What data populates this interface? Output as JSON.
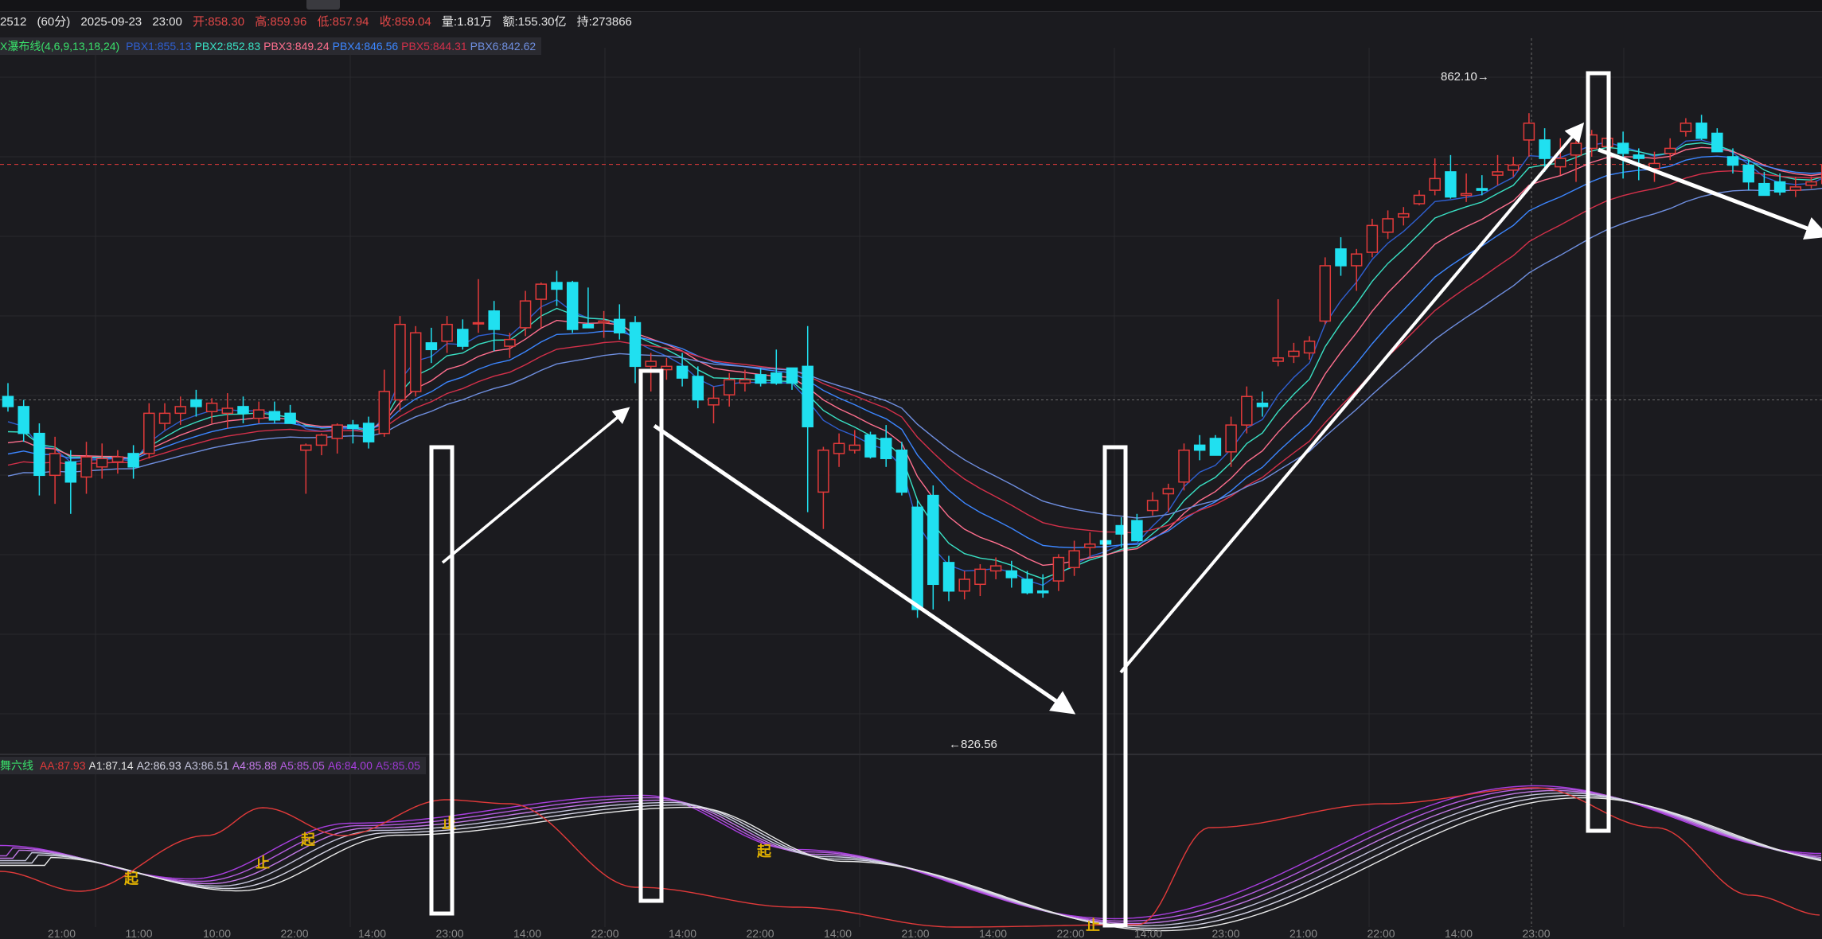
{
  "header": {
    "symbol": "2512",
    "period": "(60分)",
    "date": "2025-09-23",
    "time": "23:00",
    "open": "开:858.30",
    "high": "高:859.96",
    "low": "低:857.94",
    "close": "收:859.04",
    "volume": "量:1.81万",
    "amount": "额:155.30亿",
    "hold": "持:273866"
  },
  "legend_top": {
    "name": "X瀑布线(4,6,9,13,18,24)",
    "items": [
      {
        "text": "PBX1:855.13",
        "color": "#2f5fd0"
      },
      {
        "text": "PBX2:852.83",
        "color": "#39e0c4"
      },
      {
        "text": "PBX3:849.24",
        "color": "#ff6f8e"
      },
      {
        "text": "PBX4:846.56",
        "color": "#3c86ff"
      },
      {
        "text": "PBX5:844.31",
        "color": "#d4304a"
      },
      {
        "text": "PBX6:842.62",
        "color": "#6f8fe0"
      }
    ]
  },
  "legend_bottom": {
    "name": "舞六线",
    "items": [
      {
        "text": "AA:87.93",
        "color": "#e23a3a"
      },
      {
        "text": "A1:87.14",
        "color": "#e8e8e8"
      },
      {
        "text": "A2:86.93",
        "color": "#d6d6e6"
      },
      {
        "text": "A3:86.51",
        "color": "#c4c4dc"
      },
      {
        "text": "A4:85.88",
        "color": "#c27ae6"
      },
      {
        "text": "A5:85.05",
        "color": "#b55ce0"
      },
      {
        "text": "A6:84.00",
        "color": "#a93ee0"
      },
      {
        "text": "A5:85.05",
        "color": "#9a38d0"
      }
    ]
  },
  "annotations": {
    "high_label": "862.10→",
    "low_label": "←826.56"
  },
  "signals": [
    {
      "text": "起",
      "x": 165
    },
    {
      "text": "止",
      "x": 330
    },
    {
      "text": "起",
      "x": 387
    },
    {
      "text": "止",
      "x": 564
    },
    {
      "text": "起",
      "x": 960
    },
    {
      "text": "止",
      "x": 1373
    }
  ],
  "time_ticks": [
    "21:00",
    "11:00",
    "10:00",
    "22:00",
    "14:00",
    "23:00",
    "14:00",
    "22:00",
    "14:00",
    "22:00",
    "14:00",
    "21:00",
    "14:00",
    "22:00",
    "14:00",
    "23:00",
    "21:00",
    "22:00",
    "14:00",
    "23:00"
  ],
  "colors": {
    "up": "#e23a3a",
    "down": "#20e0f0",
    "background": "#1b1b1f",
    "grid": "#2a2a2e",
    "current_price_line": "#e23a3a",
    "crosshair": "#6a6a6a",
    "arrows": "#ffffff",
    "signal_text": "#e0b000"
  },
  "chart_data": {
    "type": "candlestick",
    "ylim": [
      824,
      866
    ],
    "current_price": 859.04,
    "crosshair_price": 845.0,
    "candles": [
      {
        "o": 845.2,
        "h": 846.0,
        "l": 844.3,
        "c": 844.6
      },
      {
        "o": 844.6,
        "h": 845.0,
        "l": 842.5,
        "c": 843.0
      },
      {
        "o": 843.0,
        "h": 843.6,
        "l": 839.3,
        "c": 840.5
      },
      {
        "o": 840.5,
        "h": 842.8,
        "l": 838.8,
        "c": 841.8
      },
      {
        "o": 841.3,
        "h": 842.0,
        "l": 838.2,
        "c": 840.1
      },
      {
        "o": 840.4,
        "h": 842.5,
        "l": 839.4,
        "c": 841.6
      },
      {
        "o": 841.0,
        "h": 842.4,
        "l": 840.3,
        "c": 841.5
      },
      {
        "o": 841.3,
        "h": 842.0,
        "l": 840.6,
        "c": 841.6
      },
      {
        "o": 841.8,
        "h": 842.3,
        "l": 840.3,
        "c": 841.0
      },
      {
        "o": 841.8,
        "h": 844.8,
        "l": 841.5,
        "c": 844.2
      },
      {
        "o": 843.6,
        "h": 844.8,
        "l": 843.2,
        "c": 844.2
      },
      {
        "o": 844.2,
        "h": 845.2,
        "l": 843.5,
        "c": 844.6
      },
      {
        "o": 845.0,
        "h": 845.6,
        "l": 844.0,
        "c": 844.6
      },
      {
        "o": 844.3,
        "h": 845.1,
        "l": 843.6,
        "c": 844.8
      },
      {
        "o": 844.2,
        "h": 845.4,
        "l": 843.3,
        "c": 844.5
      },
      {
        "o": 844.6,
        "h": 845.2,
        "l": 843.6,
        "c": 844.2
      },
      {
        "o": 843.9,
        "h": 844.9,
        "l": 843.6,
        "c": 844.4
      },
      {
        "o": 844.3,
        "h": 844.9,
        "l": 843.6,
        "c": 843.8
      },
      {
        "o": 844.2,
        "h": 844.7,
        "l": 843.7,
        "c": 843.6
      },
      {
        "o": 842.0,
        "h": 842.4,
        "l": 839.4,
        "c": 842.3
      },
      {
        "o": 842.3,
        "h": 843.0,
        "l": 841.7,
        "c": 842.9
      },
      {
        "o": 842.7,
        "h": 843.6,
        "l": 841.8,
        "c": 843.5
      },
      {
        "o": 843.5,
        "h": 843.8,
        "l": 842.4,
        "c": 843.3
      },
      {
        "o": 843.6,
        "h": 844.0,
        "l": 842.1,
        "c": 842.5
      },
      {
        "o": 843.0,
        "h": 846.8,
        "l": 842.8,
        "c": 845.5
      },
      {
        "o": 845.0,
        "h": 850.0,
        "l": 844.3,
        "c": 849.5
      },
      {
        "o": 845.5,
        "h": 849.4,
        "l": 845.2,
        "c": 849.0
      },
      {
        "o": 848.4,
        "h": 849.3,
        "l": 847.2,
        "c": 848.0
      },
      {
        "o": 848.5,
        "h": 850.0,
        "l": 847.8,
        "c": 849.5
      },
      {
        "o": 849.2,
        "h": 849.8,
        "l": 848.0,
        "c": 848.2
      },
      {
        "o": 849.6,
        "h": 852.2,
        "l": 849.0,
        "c": 849.6
      },
      {
        "o": 850.3,
        "h": 850.9,
        "l": 847.9,
        "c": 849.2
      },
      {
        "o": 848.2,
        "h": 849.0,
        "l": 847.5,
        "c": 848.6
      },
      {
        "o": 849.3,
        "h": 851.5,
        "l": 848.8,
        "c": 850.9
      },
      {
        "o": 851.0,
        "h": 852.0,
        "l": 849.3,
        "c": 851.9
      },
      {
        "o": 852.0,
        "h": 852.7,
        "l": 850.6,
        "c": 851.6
      },
      {
        "o": 852.0,
        "h": 852.1,
        "l": 849.0,
        "c": 849.2
      },
      {
        "o": 849.5,
        "h": 851.7,
        "l": 849.3,
        "c": 849.3
      },
      {
        "o": 849.6,
        "h": 850.3,
        "l": 848.7,
        "c": 849.7
      },
      {
        "o": 849.8,
        "h": 850.7,
        "l": 848.6,
        "c": 849.0
      },
      {
        "o": 849.6,
        "h": 850.0,
        "l": 846.0,
        "c": 847.0
      },
      {
        "o": 847.0,
        "h": 847.8,
        "l": 845.5,
        "c": 847.3
      },
      {
        "o": 846.8,
        "h": 847.5,
        "l": 846.2,
        "c": 847.0
      },
      {
        "o": 847.0,
        "h": 847.8,
        "l": 845.8,
        "c": 846.3
      },
      {
        "o": 846.4,
        "h": 847.0,
        "l": 844.5,
        "c": 845.0
      },
      {
        "o": 844.7,
        "h": 845.8,
        "l": 843.6,
        "c": 845.1
      },
      {
        "o": 845.3,
        "h": 846.6,
        "l": 844.6,
        "c": 846.2
      },
      {
        "o": 846.0,
        "h": 846.8,
        "l": 845.5,
        "c": 846.2
      },
      {
        "o": 846.5,
        "h": 846.9,
        "l": 845.8,
        "c": 846.0
      },
      {
        "o": 846.6,
        "h": 848.0,
        "l": 845.9,
        "c": 846.0
      },
      {
        "o": 846.9,
        "h": 846.8,
        "l": 845.6,
        "c": 846.0
      },
      {
        "o": 847.0,
        "h": 849.4,
        "l": 838.3,
        "c": 843.4
      },
      {
        "o": 839.5,
        "h": 842.2,
        "l": 837.3,
        "c": 842.0
      },
      {
        "o": 841.8,
        "h": 843.0,
        "l": 841.0,
        "c": 842.4
      },
      {
        "o": 842.0,
        "h": 843.2,
        "l": 841.8,
        "c": 842.3
      },
      {
        "o": 842.9,
        "h": 843.1,
        "l": 841.5,
        "c": 841.6
      },
      {
        "o": 842.7,
        "h": 843.5,
        "l": 841.0,
        "c": 841.5
      },
      {
        "o": 842.0,
        "h": 842.5,
        "l": 839.3,
        "c": 839.5
      },
      {
        "o": 838.6,
        "h": 839.0,
        "l": 832.0,
        "c": 832.5
      },
      {
        "o": 839.3,
        "h": 839.9,
        "l": 832.5,
        "c": 834.0
      },
      {
        "o": 835.3,
        "h": 835.7,
        "l": 833.0,
        "c": 833.6
      },
      {
        "o": 833.6,
        "h": 834.8,
        "l": 833.1,
        "c": 834.3
      },
      {
        "o": 834.0,
        "h": 835.2,
        "l": 833.3,
        "c": 834.9
      },
      {
        "o": 834.8,
        "h": 835.6,
        "l": 834.3,
        "c": 835.1
      },
      {
        "o": 834.8,
        "h": 835.4,
        "l": 833.8,
        "c": 834.4
      },
      {
        "o": 834.3,
        "h": 834.8,
        "l": 833.4,
        "c": 833.5
      },
      {
        "o": 833.6,
        "h": 834.6,
        "l": 833.2,
        "c": 833.5
      },
      {
        "o": 834.2,
        "h": 835.8,
        "l": 833.6,
        "c": 835.6
      },
      {
        "o": 835.0,
        "h": 836.6,
        "l": 834.5,
        "c": 836.0
      },
      {
        "o": 836.2,
        "h": 837.1,
        "l": 835.6,
        "c": 836.4
      },
      {
        "o": 836.6,
        "h": 837.3,
        "l": 835.8,
        "c": 836.4
      },
      {
        "o": 837.5,
        "h": 838.0,
        "l": 836.2,
        "c": 837.0
      },
      {
        "o": 837.8,
        "h": 838.2,
        "l": 836.6,
        "c": 836.6
      },
      {
        "o": 838.4,
        "h": 839.5,
        "l": 838.1,
        "c": 839.0
      },
      {
        "o": 839.4,
        "h": 840.0,
        "l": 838.3,
        "c": 839.7
      },
      {
        "o": 840.1,
        "h": 842.4,
        "l": 839.6,
        "c": 842.0
      },
      {
        "o": 842.3,
        "h": 842.9,
        "l": 841.4,
        "c": 842.0
      },
      {
        "o": 842.7,
        "h": 842.9,
        "l": 841.8,
        "c": 841.7
      },
      {
        "o": 841.9,
        "h": 844.0,
        "l": 841.0,
        "c": 843.5
      },
      {
        "o": 843.5,
        "h": 845.8,
        "l": 843.0,
        "c": 845.2
      },
      {
        "o": 844.8,
        "h": 845.5,
        "l": 844.0,
        "c": 844.6
      },
      {
        "o": 847.3,
        "h": 851.0,
        "l": 847.0,
        "c": 847.5
      },
      {
        "o": 847.6,
        "h": 848.4,
        "l": 847.2,
        "c": 847.9
      },
      {
        "o": 847.8,
        "h": 848.8,
        "l": 847.4,
        "c": 848.5
      },
      {
        "o": 849.7,
        "h": 853.5,
        "l": 849.5,
        "c": 853.0
      },
      {
        "o": 854.0,
        "h": 854.7,
        "l": 852.4,
        "c": 853.0
      },
      {
        "o": 853.0,
        "h": 854.0,
        "l": 851.5,
        "c": 853.7
      },
      {
        "o": 853.8,
        "h": 855.8,
        "l": 853.5,
        "c": 855.4
      },
      {
        "o": 855.0,
        "h": 856.3,
        "l": 854.6,
        "c": 855.8
      },
      {
        "o": 855.9,
        "h": 856.5,
        "l": 855.4,
        "c": 856.1
      },
      {
        "o": 856.7,
        "h": 857.5,
        "l": 856.6,
        "c": 857.2
      },
      {
        "o": 857.5,
        "h": 859.4,
        "l": 857.2,
        "c": 858.2
      },
      {
        "o": 858.6,
        "h": 859.6,
        "l": 857.0,
        "c": 857.1
      },
      {
        "o": 857.2,
        "h": 858.5,
        "l": 856.8,
        "c": 857.3
      },
      {
        "o": 857.6,
        "h": 858.4,
        "l": 857.2,
        "c": 857.5
      },
      {
        "o": 858.4,
        "h": 859.6,
        "l": 857.8,
        "c": 858.6
      },
      {
        "o": 858.7,
        "h": 859.5,
        "l": 858.3,
        "c": 859.0
      },
      {
        "o": 860.5,
        "h": 862.1,
        "l": 859.5,
        "c": 861.5
      },
      {
        "o": 860.5,
        "h": 861.2,
        "l": 858.6,
        "c": 859.4
      },
      {
        "o": 858.9,
        "h": 860.6,
        "l": 858.4,
        "c": 859.4
      },
      {
        "o": 859.6,
        "h": 861.0,
        "l": 858.0,
        "c": 860.3
      },
      {
        "o": 860.0,
        "h": 861.1,
        "l": 859.5,
        "c": 860.8
      },
      {
        "o": 860.1,
        "h": 861.0,
        "l": 859.6,
        "c": 860.6
      },
      {
        "o": 860.3,
        "h": 861.0,
        "l": 858.2,
        "c": 859.7
      },
      {
        "o": 859.6,
        "h": 860.0,
        "l": 858.1,
        "c": 859.4
      },
      {
        "o": 858.8,
        "h": 859.8,
        "l": 858.0,
        "c": 859.1
      },
      {
        "o": 859.7,
        "h": 860.6,
        "l": 859.3,
        "c": 860.0
      },
      {
        "o": 861.0,
        "h": 861.8,
        "l": 860.7,
        "c": 861.5
      },
      {
        "o": 861.5,
        "h": 862.0,
        "l": 860.5,
        "c": 860.6
      },
      {
        "o": 860.9,
        "h": 861.2,
        "l": 860.0,
        "c": 859.8
      },
      {
        "o": 859.5,
        "h": 860.0,
        "l": 858.5,
        "c": 859.0
      },
      {
        "o": 859.0,
        "h": 859.3,
        "l": 857.5,
        "c": 858.0
      },
      {
        "o": 857.9,
        "h": 858.6,
        "l": 857.4,
        "c": 857.2
      },
      {
        "o": 858.0,
        "h": 858.5,
        "l": 857.2,
        "c": 857.4
      },
      {
        "o": 857.5,
        "h": 858.3,
        "l": 857.1,
        "c": 857.7
      },
      {
        "o": 857.8,
        "h": 858.3,
        "l": 857.6,
        "c": 858.0
      },
      {
        "o": 857.9,
        "h": 859.0,
        "l": 857.2,
        "c": 859.0
      },
      {
        "o": 857.8,
        "h": 858.3,
        "l": 857.5,
        "c": 858.1
      },
      {
        "o": 858.1,
        "h": 858.6,
        "l": 857.5,
        "c": 858.3
      },
      {
        "o": 858.2,
        "h": 859.0,
        "l": 857.3,
        "c": 859.04
      }
    ],
    "moving_averages": [
      {
        "name": "PBX1",
        "color": "#2f5fd0",
        "last": 855.13
      },
      {
        "name": "PBX2",
        "color": "#39e0c4",
        "last": 852.83
      },
      {
        "name": "PBX3",
        "color": "#ff6f8e",
        "last": 849.24
      },
      {
        "name": "PBX4",
        "color": "#3c86ff",
        "last": 846.56
      },
      {
        "name": "PBX5",
        "color": "#d4304a",
        "last": 844.31
      },
      {
        "name": "PBX6",
        "color": "#6f8fe0",
        "last": 842.62
      }
    ]
  }
}
